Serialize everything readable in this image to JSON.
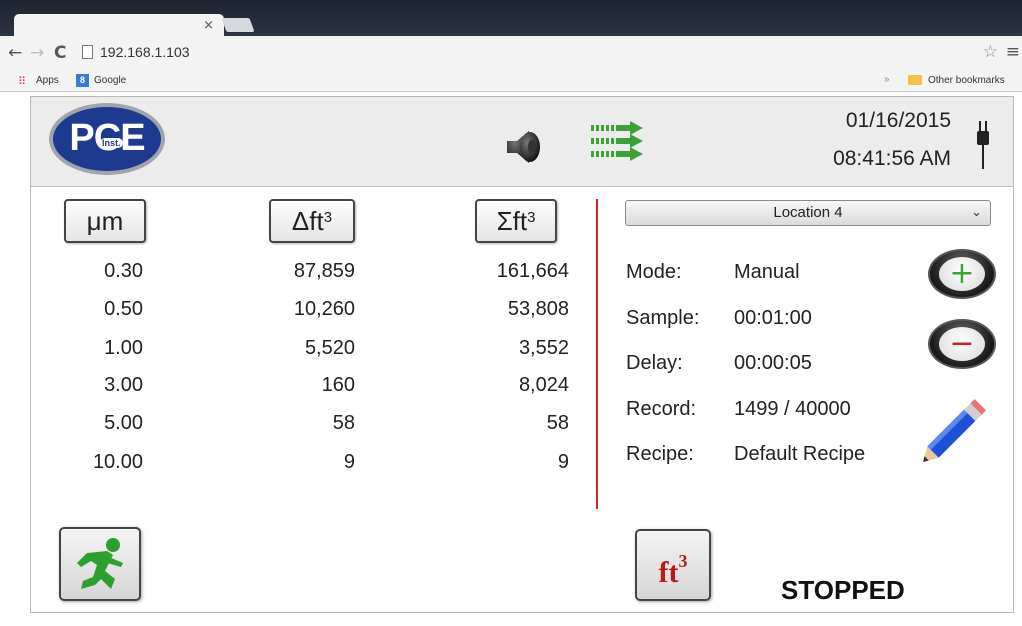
{
  "browser": {
    "url": "192.168.1.103",
    "bookmarks": {
      "apps": "Apps",
      "google": "Google",
      "other": "Other bookmarks"
    }
  },
  "header": {
    "logo_text": "PCE",
    "logo_inst": "Inst.",
    "date": "01/16/2015",
    "time": "08:41:56 AM"
  },
  "table": {
    "headers": {
      "size": "μm",
      "delta": "Δft",
      "sum": "Σft",
      "unit_exp": "3"
    },
    "rows": [
      {
        "size": "0.30",
        "delta": "87,859",
        "sum": "161,664"
      },
      {
        "size": "0.50",
        "delta": "10,260",
        "sum": "53,808"
      },
      {
        "size": "1.00",
        "delta": "5,520",
        "sum": "3,552"
      },
      {
        "size": "3.00",
        "delta": "160",
        "sum": "8,024"
      },
      {
        "size": "5.00",
        "delta": "58",
        "sum": "58"
      },
      {
        "size": "10.00",
        "delta": "9",
        "sum": "9"
      }
    ]
  },
  "panel": {
    "location": "Location 4",
    "mode_label": "Mode:",
    "mode_value": "Manual",
    "sample_label": "Sample:",
    "sample_value": "00:01:00",
    "delay_label": "Delay:",
    "delay_value": "00:00:05",
    "record_label": "Record:",
    "record_value": "1499 / 40000",
    "recipe_label": "Recipe:",
    "recipe_value": "Default Recipe"
  },
  "footer": {
    "unit_label": "ft",
    "unit_exp": "3",
    "status": "STOPPED"
  },
  "colors": {
    "accent_red": "#c62828",
    "logo_blue": "#1e3a8f",
    "run_green": "#2e9e2e"
  }
}
